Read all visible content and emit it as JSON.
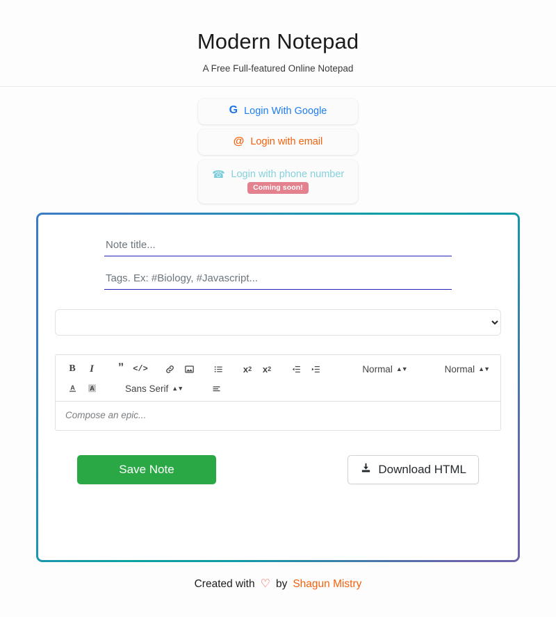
{
  "header": {
    "title": "Modern Notepad",
    "subtitle": "A Free Full-featured Online Notepad"
  },
  "login": {
    "google": {
      "label": "Login With Google",
      "icon": "google-g-icon",
      "color": "#1f7ded"
    },
    "email": {
      "label": "Login with email",
      "icon": "at-sign-icon",
      "color": "#f4610b"
    },
    "phone": {
      "label": "Login with phone number",
      "icon": "phone-icon",
      "color": "#84d2dd",
      "badge": "Coming soon!",
      "badge_color": "#e4818f"
    }
  },
  "editor": {
    "title_placeholder": "Note title...",
    "title_value": "",
    "tags_placeholder": "Tags. Ex: #Biology, #Javascript...",
    "tags_value": "",
    "note_select_value": "",
    "note_select_options": [
      ""
    ],
    "body_placeholder": "Compose an epic...",
    "body_value": "",
    "toolbar": {
      "bold": "B",
      "italic": "I",
      "blockquote": "”",
      "code_block": "</>",
      "link": "link-icon",
      "image": "image-icon",
      "list": "bullet-list-icon",
      "subscript": "x",
      "subscript_sub": "2",
      "superscript": "x",
      "superscript_sup": "2",
      "outdent": "outdent-icon",
      "indent": "indent-icon",
      "header_picker": "Normal",
      "size_picker": "Normal",
      "color": "text-color-icon",
      "background": "background-color-icon",
      "font_picker": "Sans Serif",
      "align": "align-icon"
    }
  },
  "actions": {
    "save_label": "Save Note",
    "save_color": "#2ba846",
    "download_label": "Download HTML",
    "download_icon": "download-icon"
  },
  "footer": {
    "created_with": "Created with",
    "heart": "♡",
    "by": "by",
    "author": "Shagun Mistry",
    "author_color": "#f4610b"
  },
  "card": {
    "border_gradient_start": "#3b7dc4",
    "border_gradient_mid": "#0ba2a2",
    "border_gradient_end": "#6a64ab"
  }
}
